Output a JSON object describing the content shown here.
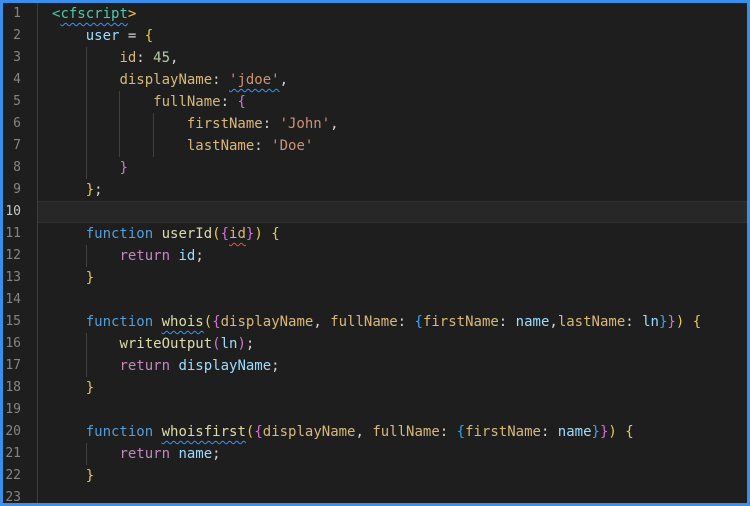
{
  "editor": {
    "background": "#1e1e1e",
    "frame_border_color": "#3b8eea",
    "gutter_divider_color": "#3d3d3d",
    "indent_guide_color": "#404040",
    "line_number_color": "#858585",
    "active_line_number_color": "#c6c6c6",
    "active_line": 10,
    "language_hint": "cfscript",
    "token_colors": {
      "tag": "#4ec9b0",
      "keyword": "#569cd6",
      "control": "#c586c0",
      "function": "#dcdcaa",
      "property": "#d9b77a",
      "variable": "#9cdcfe",
      "string": "#ce9178",
      "number": "#b5cea8",
      "punct": "#d4d4d4",
      "bracket1": "#e7c950",
      "bracket2": "#d670d6",
      "bracket3": "#35a2f2",
      "ws": "#d4d4d4"
    },
    "squiggle_colors": {
      "blue": "#3794ff",
      "red": "#f14c4c"
    },
    "lines": [
      {
        "n": 1,
        "guides": [],
        "tokens": [
          [
            "tag",
            "<"
          ],
          [
            "tag",
            "cfscript",
            "blue"
          ],
          [
            "bracket1",
            ">"
          ]
        ]
      },
      {
        "n": 2,
        "guides": [],
        "tokens": [
          [
            "ws",
            "    "
          ],
          [
            "variable",
            "user"
          ],
          [
            "punct",
            " = "
          ],
          [
            "bracket1",
            "{"
          ]
        ]
      },
      {
        "n": 3,
        "guides": [
          4
        ],
        "tokens": [
          [
            "ws",
            "        "
          ],
          [
            "property",
            "id"
          ],
          [
            "punct",
            ": "
          ],
          [
            "number",
            "45"
          ],
          [
            "punct",
            ","
          ]
        ]
      },
      {
        "n": 4,
        "guides": [
          4
        ],
        "tokens": [
          [
            "ws",
            "        "
          ],
          [
            "property",
            "displayName"
          ],
          [
            "punct",
            ": "
          ],
          [
            "string",
            "'jdoe'",
            "blue"
          ],
          [
            "punct",
            ","
          ]
        ]
      },
      {
        "n": 5,
        "guides": [
          4,
          8
        ],
        "tokens": [
          [
            "ws",
            "            "
          ],
          [
            "property",
            "fullName"
          ],
          [
            "punct",
            ": "
          ],
          [
            "bracket2",
            "{"
          ]
        ]
      },
      {
        "n": 6,
        "guides": [
          4,
          8,
          12
        ],
        "tokens": [
          [
            "ws",
            "                "
          ],
          [
            "property",
            "firstName"
          ],
          [
            "punct",
            ": "
          ],
          [
            "string",
            "'John'"
          ],
          [
            "punct",
            ","
          ]
        ]
      },
      {
        "n": 7,
        "guides": [
          4,
          8,
          12
        ],
        "tokens": [
          [
            "ws",
            "                "
          ],
          [
            "property",
            "lastName"
          ],
          [
            "punct",
            ": "
          ],
          [
            "string",
            "'Doe'"
          ]
        ]
      },
      {
        "n": 8,
        "guides": [
          4
        ],
        "tokens": [
          [
            "ws",
            "        "
          ],
          [
            "bracket2",
            "}"
          ]
        ]
      },
      {
        "n": 9,
        "guides": [],
        "tokens": [
          [
            "ws",
            "    "
          ],
          [
            "bracket1",
            "}"
          ],
          [
            "punct",
            ";"
          ]
        ]
      },
      {
        "n": 10,
        "guides": [],
        "tokens": []
      },
      {
        "n": 11,
        "guides": [],
        "tokens": [
          [
            "ws",
            "    "
          ],
          [
            "keyword",
            "function"
          ],
          [
            "punct",
            " "
          ],
          [
            "function",
            "userId"
          ],
          [
            "bracket1",
            "("
          ],
          [
            "bracket2",
            "{"
          ],
          [
            "property",
            "id",
            "red"
          ],
          [
            "bracket2",
            "}"
          ],
          [
            "bracket1",
            ")"
          ],
          [
            "punct",
            " "
          ],
          [
            "bracket1",
            "{"
          ]
        ]
      },
      {
        "n": 12,
        "guides": [
          4
        ],
        "tokens": [
          [
            "ws",
            "        "
          ],
          [
            "control",
            "return"
          ],
          [
            "punct",
            " "
          ],
          [
            "variable",
            "id"
          ],
          [
            "punct",
            ";"
          ]
        ]
      },
      {
        "n": 13,
        "guides": [],
        "tokens": [
          [
            "ws",
            "    "
          ],
          [
            "bracket1",
            "}"
          ]
        ]
      },
      {
        "n": 14,
        "guides": [],
        "tokens": []
      },
      {
        "n": 15,
        "guides": [],
        "tokens": [
          [
            "ws",
            "    "
          ],
          [
            "keyword",
            "function"
          ],
          [
            "punct",
            " "
          ],
          [
            "function",
            "whois",
            "blue"
          ],
          [
            "bracket1",
            "("
          ],
          [
            "bracket2",
            "{"
          ],
          [
            "property",
            "displayName"
          ],
          [
            "punct",
            ", "
          ],
          [
            "property",
            "fullName"
          ],
          [
            "punct",
            ": "
          ],
          [
            "bracket3",
            "{"
          ],
          [
            "property",
            "firstName"
          ],
          [
            "punct",
            ": "
          ],
          [
            "variable",
            "name"
          ],
          [
            "punct",
            ","
          ],
          [
            "property",
            "lastName"
          ],
          [
            "punct",
            ": "
          ],
          [
            "variable",
            "ln"
          ],
          [
            "bracket3",
            "}"
          ],
          [
            "bracket2",
            "}"
          ],
          [
            "bracket1",
            ")"
          ],
          [
            "punct",
            " "
          ],
          [
            "bracket1",
            "{"
          ]
        ]
      },
      {
        "n": 16,
        "guides": [
          4
        ],
        "tokens": [
          [
            "ws",
            "        "
          ],
          [
            "function",
            "writeOutput"
          ],
          [
            "bracket2",
            "("
          ],
          [
            "variable",
            "ln"
          ],
          [
            "bracket2",
            ")"
          ],
          [
            "punct",
            ";"
          ]
        ]
      },
      {
        "n": 17,
        "guides": [
          4
        ],
        "tokens": [
          [
            "ws",
            "        "
          ],
          [
            "control",
            "return"
          ],
          [
            "punct",
            " "
          ],
          [
            "variable",
            "displayName"
          ],
          [
            "punct",
            ";"
          ]
        ]
      },
      {
        "n": 18,
        "guides": [],
        "tokens": [
          [
            "ws",
            "    "
          ],
          [
            "bracket1",
            "}"
          ]
        ]
      },
      {
        "n": 19,
        "guides": [],
        "tokens": []
      },
      {
        "n": 20,
        "guides": [],
        "tokens": [
          [
            "ws",
            "    "
          ],
          [
            "keyword",
            "function"
          ],
          [
            "punct",
            " "
          ],
          [
            "function",
            "whoisfirst",
            "blue"
          ],
          [
            "bracket1",
            "("
          ],
          [
            "bracket2",
            "{"
          ],
          [
            "property",
            "displayName"
          ],
          [
            "punct",
            ", "
          ],
          [
            "property",
            "fullName"
          ],
          [
            "punct",
            ": "
          ],
          [
            "bracket3",
            "{"
          ],
          [
            "property",
            "firstName"
          ],
          [
            "punct",
            ": "
          ],
          [
            "variable",
            "name"
          ],
          [
            "bracket3",
            "}"
          ],
          [
            "bracket2",
            "}"
          ],
          [
            "bracket1",
            ")"
          ],
          [
            "punct",
            " "
          ],
          [
            "bracket1",
            "{"
          ]
        ]
      },
      {
        "n": 21,
        "guides": [
          4
        ],
        "tokens": [
          [
            "ws",
            "        "
          ],
          [
            "control",
            "return"
          ],
          [
            "punct",
            " "
          ],
          [
            "variable",
            "name"
          ],
          [
            "punct",
            ";"
          ]
        ]
      },
      {
        "n": 22,
        "guides": [],
        "tokens": [
          [
            "ws",
            "    "
          ],
          [
            "bracket1",
            "}"
          ]
        ]
      },
      {
        "n": 23,
        "guides": [],
        "tokens": []
      }
    ]
  }
}
